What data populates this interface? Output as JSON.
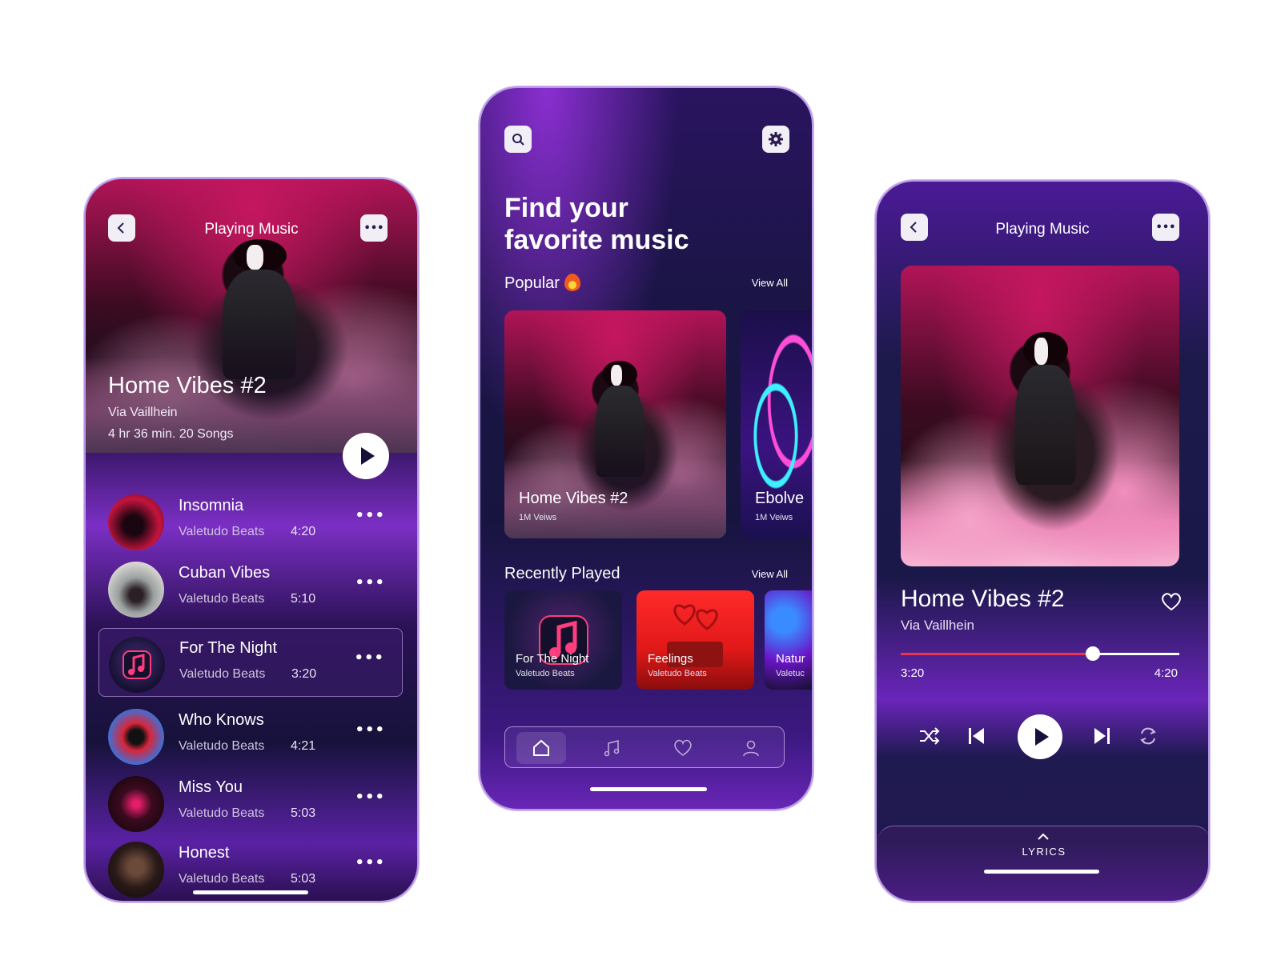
{
  "left": {
    "header_title": "Playing Music",
    "back_icon": "chevron-left-icon",
    "more_icon": "more-dots-icon",
    "album_title": "Home Vibes #2",
    "album_artist": "Via Vaillhein",
    "album_meta": "4 hr 36 min. 20 Songs",
    "songs": [
      {
        "name": "Insomnia",
        "artist": "Valetudo Beats",
        "duration": "4:20"
      },
      {
        "name": "Cuban Vibes",
        "artist": "Valetudo Beats",
        "duration": "5:10"
      },
      {
        "name": "For The Night",
        "artist": "Valetudo Beats",
        "duration": "3:20"
      },
      {
        "name": "Who Knows",
        "artist": "Valetudo Beats",
        "duration": "4:21"
      },
      {
        "name": "Miss You",
        "artist": "Valetudo Beats",
        "duration": "5:03"
      },
      {
        "name": "Honest",
        "artist": "Valetudo Beats",
        "duration": "5:03"
      }
    ],
    "more_glyph": "•••"
  },
  "middle": {
    "heading_line1": "Find your",
    "heading_line2": "favorite music",
    "popular_label": "Popular",
    "view_all": "View All",
    "popular_cards": [
      {
        "title": "Home Vibes #2",
        "views": "1M Veiws"
      },
      {
        "title": "Ebolve",
        "views": "1M Veiws"
      }
    ],
    "recent_label": "Recently Played",
    "recent_cards": [
      {
        "title": "For The Night",
        "artist": "Valetudo Beats"
      },
      {
        "title": "Feelings",
        "artist": "Valetudo Beats"
      },
      {
        "title": "Natur",
        "artist": "Valetuc"
      }
    ],
    "tabs": [
      "home-icon",
      "music-note-icon",
      "heart-icon",
      "profile-icon"
    ],
    "active_tab": "home-icon"
  },
  "right": {
    "header_title": "Playing Music",
    "song_title": "Home Vibes #2",
    "song_artist": "Via Vaillhein",
    "elapsed": "3:20",
    "total": "4:20",
    "progress": 0.69,
    "lyrics_label": "LYRICS"
  },
  "colors": {
    "accent_red": "#e9334f",
    "deep_purple": "#1a1545",
    "bright_purple": "#7b2fc4"
  }
}
